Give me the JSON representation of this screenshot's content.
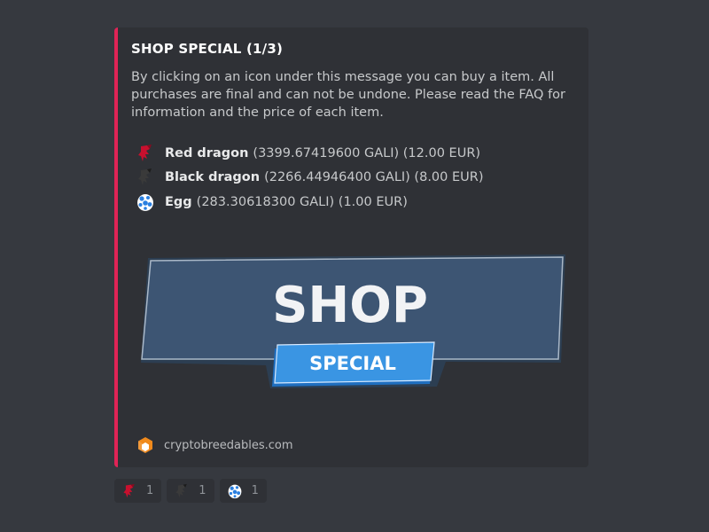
{
  "embed": {
    "accent_color": "#e02456",
    "title": "SHOP SPECIAL (1/3)",
    "description": "By clicking on an icon under this message you can buy a item. All purchases are final and can not be undone. Please read the FAQ for information and the price of each item.",
    "items": [
      {
        "icon": "red-dragon-icon",
        "name": "Red dragon",
        "price": "(3399.67419600 GALI) (12.00 EUR)"
      },
      {
        "icon": "black-dragon-icon",
        "name": "Black dragon",
        "price": "(2266.44946400 GALI) (8.00 EUR)"
      },
      {
        "icon": "egg-icon",
        "name": "Egg",
        "price": "(283.30618300 GALI) (1.00 EUR)"
      }
    ],
    "banner": {
      "main_text": "SHOP",
      "ribbon_text": "SPECIAL"
    },
    "footer": {
      "icon": "cryptobreedables-logo-icon",
      "text": "cryptobreedables.com"
    }
  },
  "reactions": [
    {
      "icon": "red-dragon-icon",
      "count": "1"
    },
    {
      "icon": "black-dragon-icon",
      "count": "1"
    },
    {
      "icon": "egg-icon",
      "count": "1"
    }
  ]
}
